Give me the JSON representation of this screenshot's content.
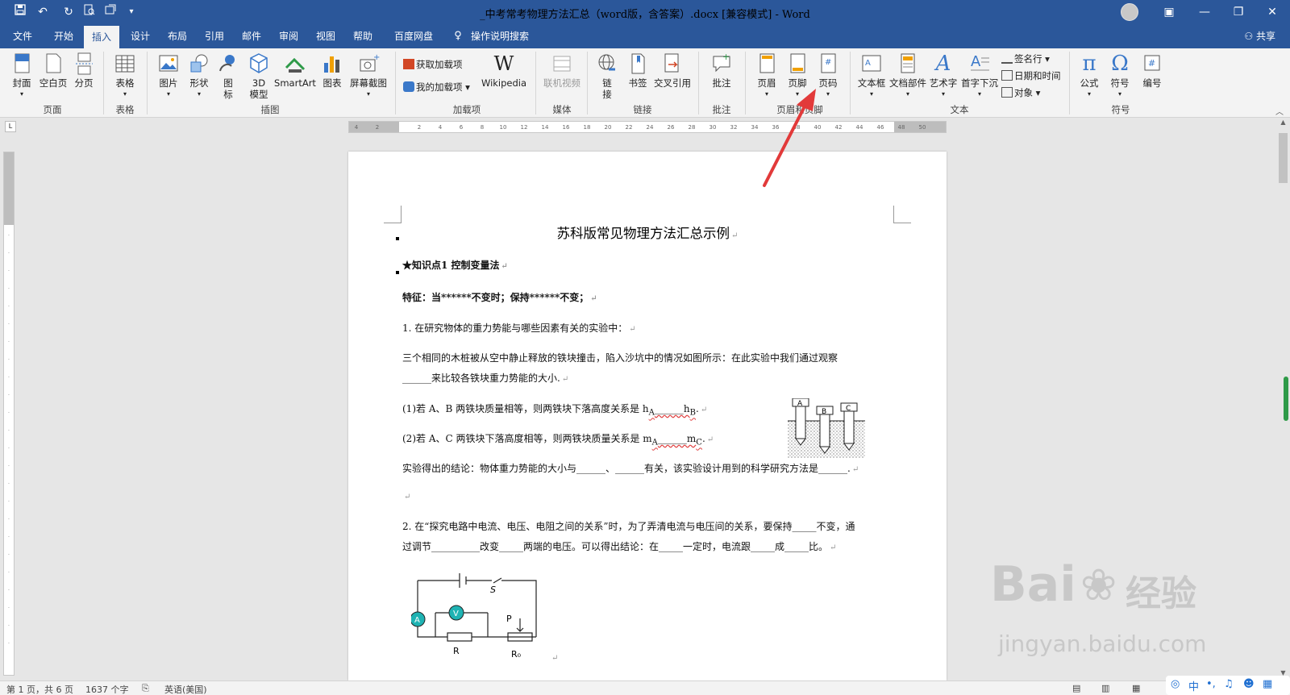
{
  "titlebar": {
    "title": "_中考常考物理方法汇总（word版，含答案）.docx [兼容模式] - Word",
    "window_buttons": [
      "ribbon-display-icon",
      "minimize-icon",
      "restore-icon",
      "close-icon"
    ]
  },
  "tabs": {
    "file": "文件",
    "home": "开始",
    "insert": "插入",
    "design": "设计",
    "layout": "布局",
    "references": "引用",
    "mailings": "邮件",
    "review": "审阅",
    "view": "视图",
    "help": "帮助",
    "baidu": "百度网盘",
    "tellme": "操作说明搜索",
    "share": "共享"
  },
  "ribbon": {
    "pages": {
      "cover": "封面",
      "blank": "空白页",
      "break": "分页",
      "group": "页面"
    },
    "tables": {
      "table": "表格",
      "group": "表格"
    },
    "illustrations": {
      "picture": "图片",
      "shapes": "形状",
      "icons_l1": "图",
      "icons_l2": "标",
      "model_l1": "3D",
      "model_l2": "模型",
      "smartart": "SmartArt",
      "chart": "图表",
      "screenshot": "屏幕截图",
      "group": "插图"
    },
    "addins": {
      "get": "获取加载项",
      "my": "我的加载项",
      "wikipedia": "Wikipedia",
      "group": "加载项"
    },
    "media": {
      "video": "联机视频",
      "group": "媒体"
    },
    "links": {
      "link_l1": "链",
      "link_l2": "接",
      "bookmark": "书签",
      "crossref": "交叉引用",
      "group": "链接"
    },
    "comments": {
      "comment": "批注",
      "group": "批注"
    },
    "headerfooter": {
      "header": "页眉",
      "footer": "页脚",
      "pagenum": "页码",
      "group": "页眉和页脚"
    },
    "text": {
      "textbox": "文本框",
      "quickparts": "文档部件",
      "wordart": "艺术字",
      "dropcap": "首字下沉",
      "signature": "签名行",
      "datetime": "日期和时间",
      "object": "对象",
      "group": "文本"
    },
    "symbols": {
      "equation": "公式",
      "symbol": "符号",
      "number": "编号",
      "group": "符号"
    }
  },
  "document": {
    "title": "苏科版常见物理方法汇总示例",
    "kp1": "★知识点1 控制变量法",
    "feature": "特征：当******不变时；保持******不变；",
    "q1": "1. 在研究物体的重力势能与哪些因素有关的实验中：",
    "q1_desc1": "三个相同的木桩被从空中静止释放的铁块撞击，陷入沙坑中的情况如图所示：在此实验中我们通过观察",
    "q1_desc2": "______来比较各铁块重力势能的大小.",
    "q1_p1_pre": "(1)若 A、B 两铁块质量相等，则两铁块下落高度关系是 h",
    "q1_p1_sub": "A",
    "q1_p1_mid": "______h",
    "q1_p1_sub2": "B",
    "q1_p1_end": ".",
    "q1_p2_pre": "(2)若 A、C 两铁块下落高度相等，则两铁块质量关系是 m",
    "q1_p2_sub": "A",
    "q1_p2_mid": "______m",
    "q1_p2_sub2": "C",
    "q1_p2_end": ".",
    "q1_conclusion": "实验得出的结论：物体重力势能的大小与______、______有关，该实验设计用到的科学研究方法是______.",
    "q2_l1": "2. 在“探究电路中电流、电压、电阻之间的关系”时，为了弄清电流与电压间的关系，要保持_____不变，通",
    "q2_l2": "过调节__________改变_____两端的电压。可以得出结论：在_____一定时，电流跟_____成_____比。",
    "para_mark": "↵",
    "peg_labels": [
      "A",
      "B",
      "C"
    ],
    "circuit_labels": {
      "switch": "S",
      "ammeter": "A",
      "voltmeter": "V",
      "resistor": "R",
      "rheostat": "R₀",
      "slider": "P"
    }
  },
  "ruler_ticks": [
    "4",
    "2",
    "",
    "2",
    "4",
    "6",
    "8",
    "10",
    "12",
    "14",
    "16",
    "18",
    "20",
    "22",
    "24",
    "26",
    "28",
    "30",
    "32",
    "34",
    "36",
    "38",
    "40",
    "42",
    "44",
    "46",
    "48",
    "50"
  ],
  "status": {
    "page": "第 1 页，共 6 页",
    "words": "1637 个字",
    "lang": "英语(美国)"
  },
  "ime": {
    "lang": "中"
  },
  "watermark": {
    "brand": "Bai",
    "brand2": "经验",
    "url": "jingyan.baidu.com"
  },
  "colors": {
    "word_blue": "#2b579a",
    "ribbon_bg": "#f3f3f3",
    "arrow_red": "#e23a3a"
  }
}
